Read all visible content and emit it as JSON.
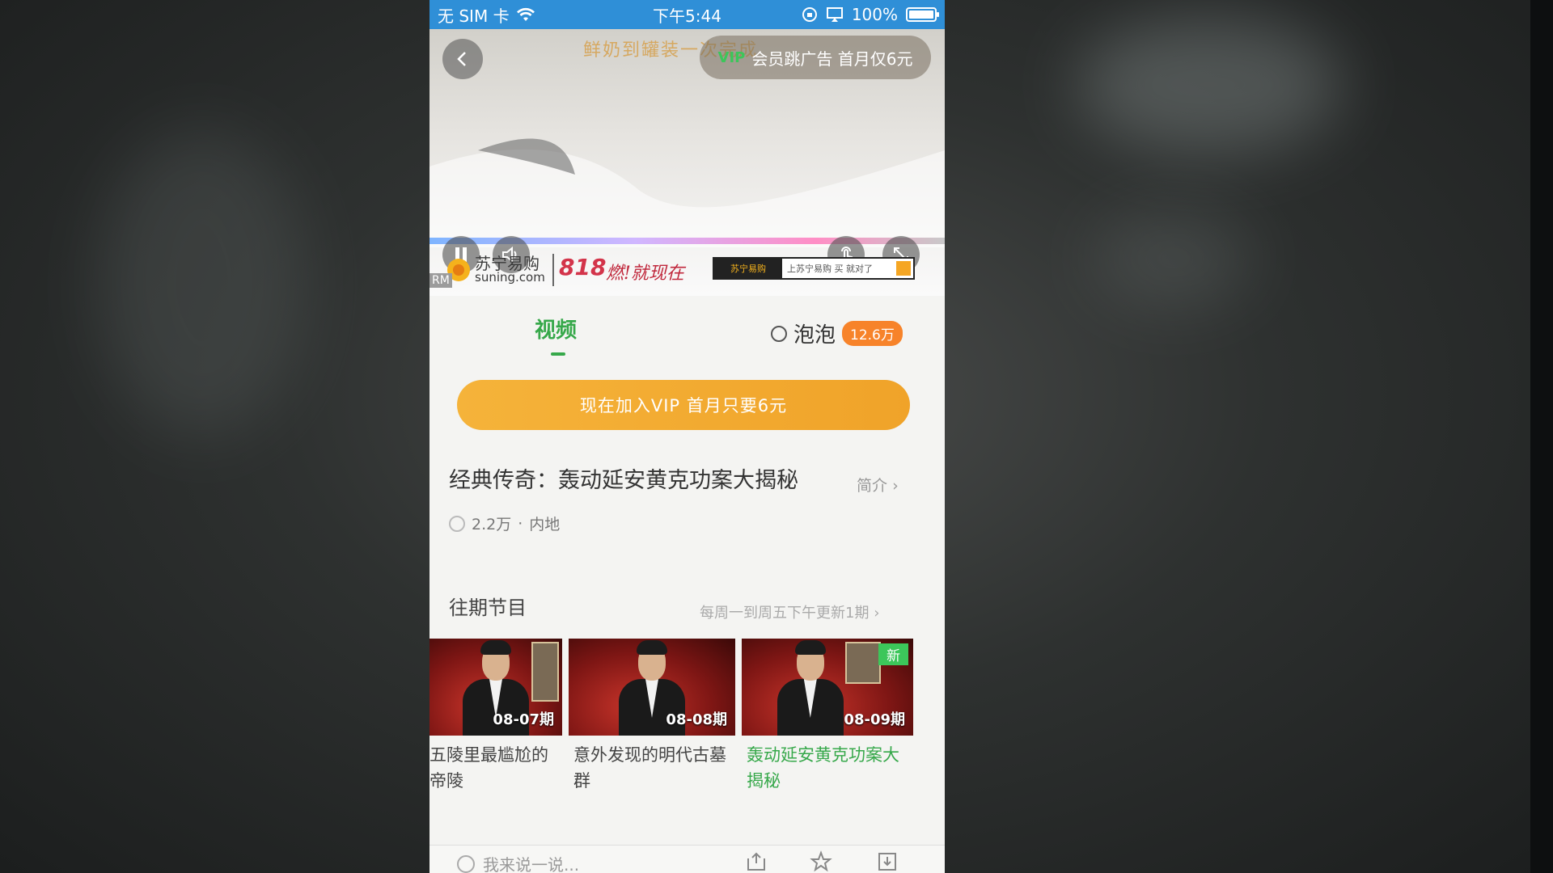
{
  "status_bar": {
    "carrier": "无 SIM 卡",
    "time": "下午5:44",
    "battery": "100%"
  },
  "player": {
    "ad_slogan": "鲜奶到罐装一次完成",
    "vip_skip": "会员跳广告 首月仅6元",
    "vip_skip_mini": "VIP",
    "ad_brand_cn": "苏宁易购",
    "ad_brand_en": "suning.com",
    "ad_818": "818",
    "ad_slogan2": "燃!就现在",
    "ad_tag": "RM",
    "mini_banner_logo": "苏宁易购",
    "mini_banner_text": "上苏宁易购 买 就对了",
    "icons": [
      "back-icon",
      "pause-icon",
      "volume-icon",
      "gesture-icon",
      "fullscreen-icon"
    ]
  },
  "tabs": {
    "video": "视频",
    "bubble": "泡泡",
    "bubble_count": "12.6万"
  },
  "vip_banner": "现在加入VIP  首月只要6元",
  "program": {
    "title": "经典传奇：轰动延安黄克功案大揭秘",
    "intro": "简介",
    "views": "2.2万",
    "region": "内地",
    "meta_sep": "·"
  },
  "past": {
    "title": "往期节目",
    "schedule": "每周一到周五下午更新1期",
    "episodes": [
      {
        "label": "08-07期",
        "title": "五陵里最尴尬的帝陵",
        "is_new": false,
        "active": false
      },
      {
        "label": "08-08期",
        "title": "意外发现的明代古墓群",
        "is_new": false,
        "active": false
      },
      {
        "label": "08-09期",
        "title": "轰动延安黄克功案大揭秘",
        "is_new": true,
        "new_label": "新",
        "active": true
      }
    ]
  },
  "bottom_bar": {
    "comment_placeholder": "我来说一说..."
  },
  "colors": {
    "status_bar": "#2f8fd7",
    "accent_green": "#36a84a",
    "vip_orange": "#f5b33a",
    "badge_orange": "#f7832a"
  }
}
